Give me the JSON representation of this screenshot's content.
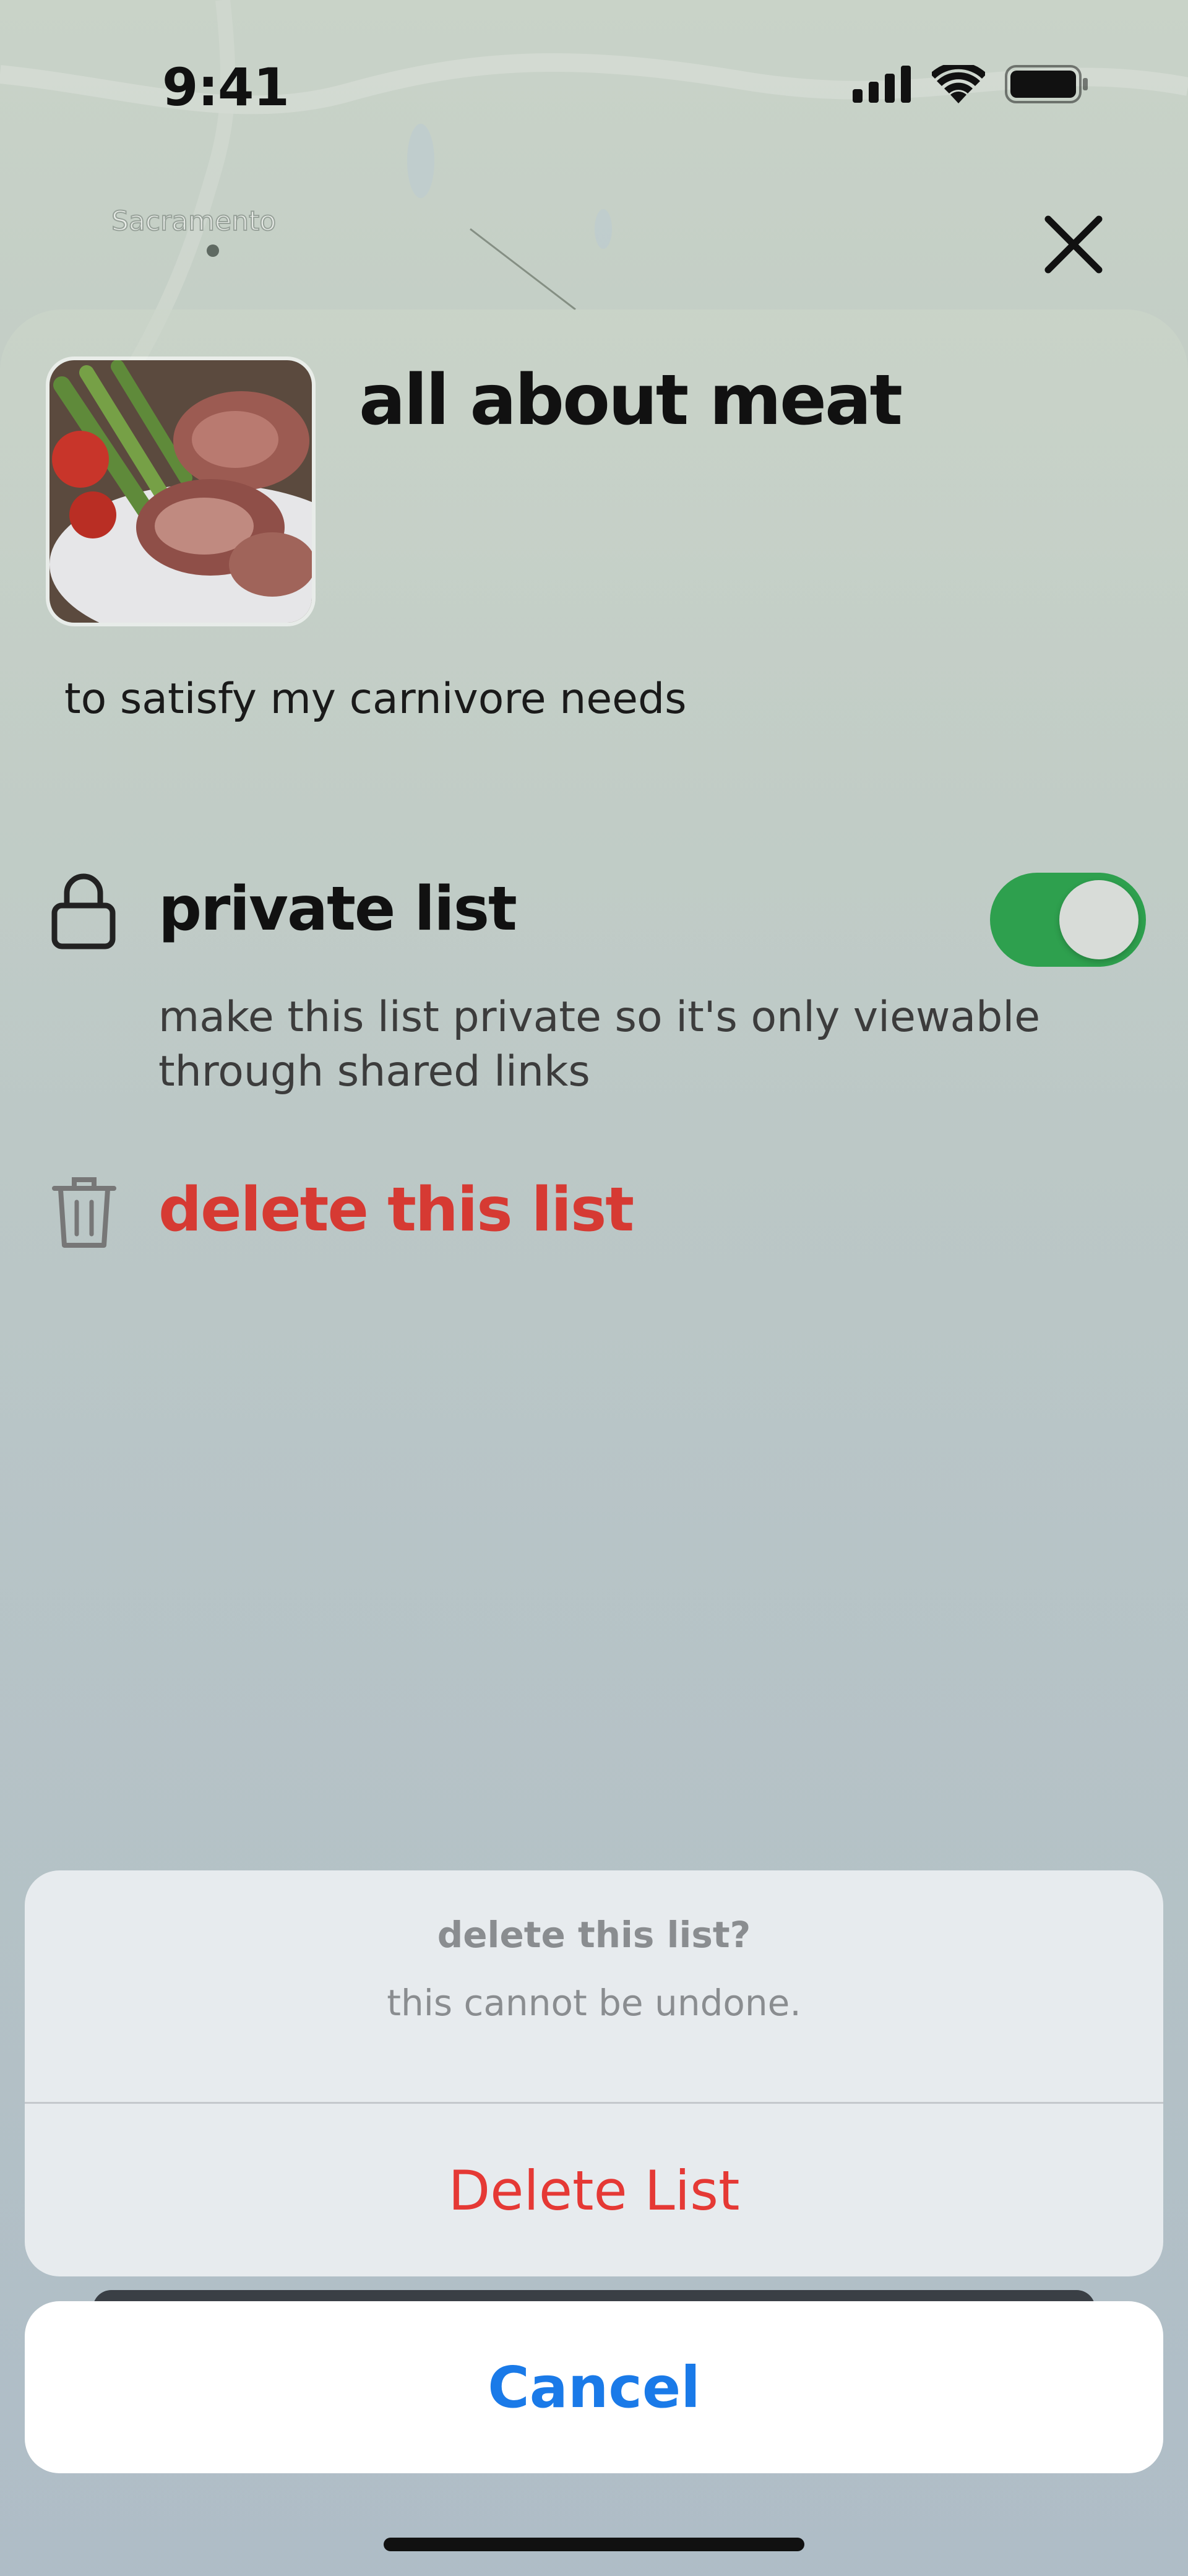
{
  "status_bar": {
    "time": "9:41",
    "icons": [
      "cellular-signal-icon",
      "wifi-icon",
      "battery-icon"
    ]
  },
  "map": {
    "place_label": "Sacramento"
  },
  "list": {
    "title": "all about meat",
    "description": "to satisfy my carnivore needs",
    "cover_icon": "food-photo-thumbnail"
  },
  "privacy": {
    "label": "private list",
    "help": "make this list private so it's only viewable through shared links",
    "enabled": true,
    "toggle_color": "#2ea04e"
  },
  "delete": {
    "label": "delete this list",
    "color": "#d63a33"
  },
  "action_sheet": {
    "title": "delete this list?",
    "message": "this cannot be undone.",
    "destructive_label": "Delete List",
    "cancel_label": "Cancel",
    "destructive_color": "#e53935",
    "cancel_color": "#1a7ae8"
  }
}
